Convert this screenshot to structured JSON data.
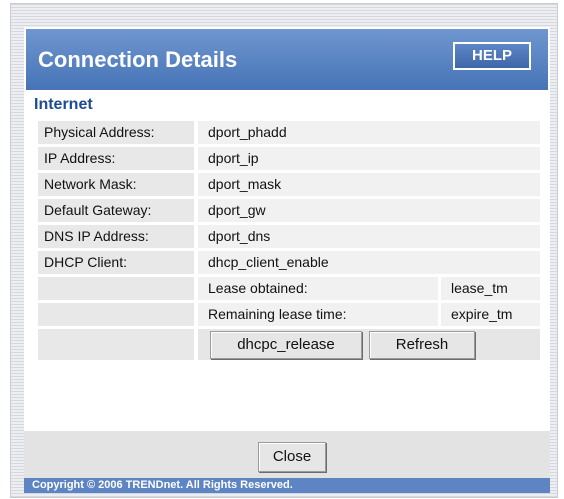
{
  "header": {
    "title": "Connection Details",
    "help_label": "HELP"
  },
  "section": {
    "title": "Internet"
  },
  "rows": [
    {
      "label": "Physical Address:",
      "value": "dport_phadd"
    },
    {
      "label": "IP Address:",
      "value": "dport_ip"
    },
    {
      "label": "Network Mask:",
      "value": "dport_mask"
    },
    {
      "label": "Default Gateway:",
      "value": "dport_gw"
    },
    {
      "label": "DNS IP Address:",
      "value": "dport_dns"
    },
    {
      "label": "DHCP Client:",
      "value": "dhcp_client_enable"
    }
  ],
  "lease": {
    "obtained_label": "Lease obtained:",
    "obtained_value": "lease_tm",
    "remaining_label": "Remaining lease time:",
    "remaining_value": "expire_tm"
  },
  "buttons": {
    "release": "dhcpc_release",
    "refresh": "Refresh",
    "close": "Close"
  },
  "footer": {
    "copyright": "Copyright © 2006 TRENDnet. All Rights Reserved."
  }
}
